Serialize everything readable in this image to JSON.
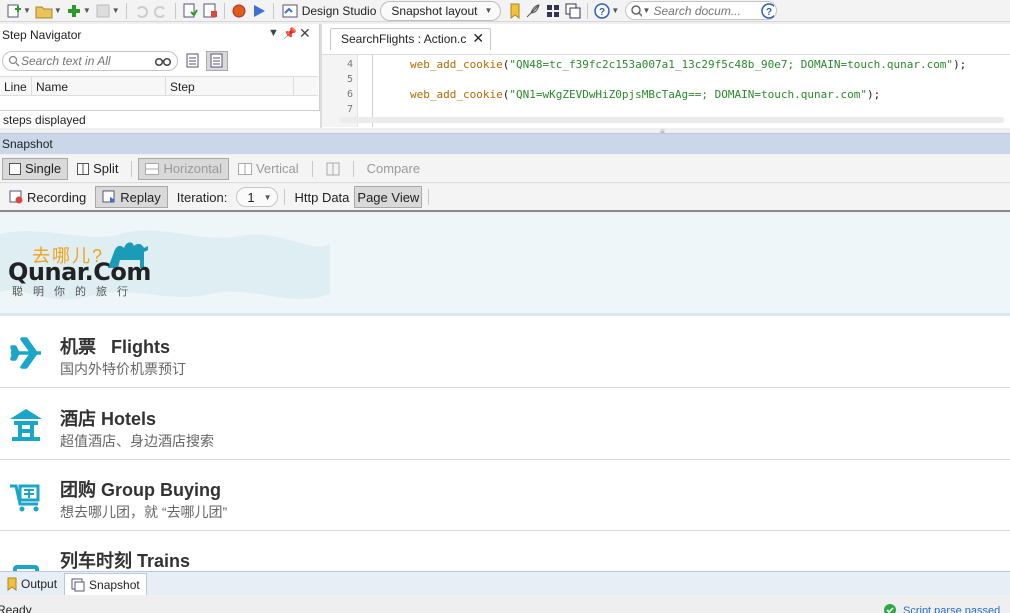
{
  "toolbar": {
    "design_studio": "Design Studio",
    "snapshot_layout": "Snapshot layout",
    "search_placeholder": "Search docum..."
  },
  "step_navigator": {
    "title": "Step Navigator",
    "search_placeholder": "Search text in All",
    "columns": [
      "Line",
      "Name",
      "Step"
    ],
    "footer": "steps displayed"
  },
  "editor": {
    "tab_label": "SearchFlights : Action.c",
    "lines": [
      {
        "num": "4",
        "fn": "web_add_cookie",
        "arg": "\"QN48=tc_f39fc2c153a007a1_13c29f5c48b_90e7; DOMAIN=touch.qunar.com\""
      },
      {
        "num": "5",
        "fn": "",
        "arg": ""
      },
      {
        "num": "6",
        "fn": "web_add_cookie",
        "arg": "\"QN1=wKgZEVDwHiZ0pjsMBcTaAg==; DOMAIN=touch.qunar.com\""
      },
      {
        "num": "7",
        "fn": "",
        "arg": ""
      }
    ]
  },
  "snapshot": {
    "title": "Snapshot",
    "view_buttons": {
      "single": "Single",
      "split": "Split",
      "horizontal": "Horizontal",
      "vertical": "Vertical",
      "compare": "Compare"
    },
    "source_buttons": {
      "recording": "Recording",
      "replay": "Replay",
      "iteration_label": "Iteration:",
      "iteration_value": "1",
      "http_data": "Http Data",
      "page_view": "Page View"
    }
  },
  "webpage": {
    "logo_cn": "去哪儿?",
    "logo_en": "Qunar.Com",
    "logo_tagline": "聪明你的旅行",
    "menu": [
      {
        "title": "机票   Flights",
        "subtitle": "国内外特价机票预订",
        "icon": "plane-icon"
      },
      {
        "title": "酒店 Hotels",
        "subtitle": "超值酒店、身边酒店搜索",
        "icon": "hotel-icon"
      },
      {
        "title": "团购 Group Buying",
        "subtitle": "想去哪儿团，就 “去哪儿团”",
        "icon": "cart-icon"
      },
      {
        "title": "列车时刻 Trains",
        "subtitle": "",
        "icon": "train-icon"
      }
    ],
    "accent_color": "#1aa6c8"
  },
  "bottom_tabs": {
    "output": "Output",
    "snapshot": "Snapshot"
  },
  "status": {
    "left": "Ready",
    "right": "Script parse passed"
  }
}
